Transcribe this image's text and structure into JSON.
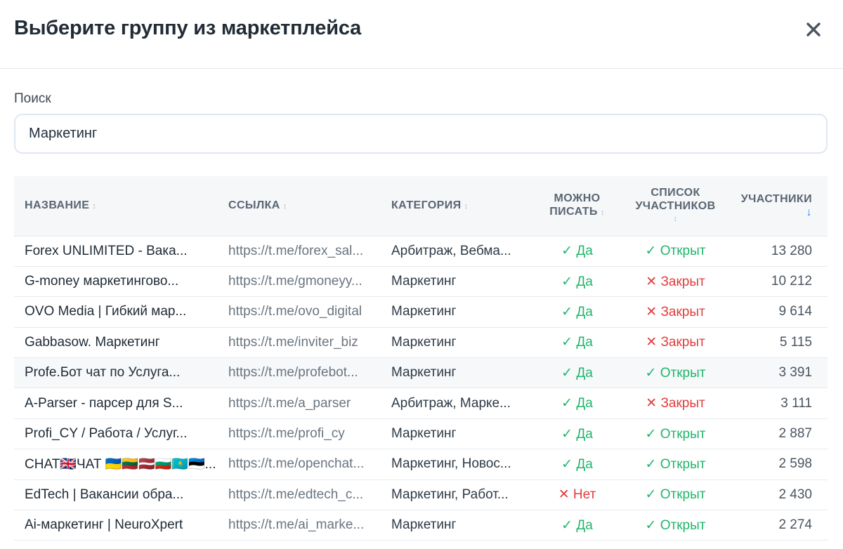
{
  "dialog": {
    "title": "Выберите группу из маркетплейса",
    "close_icon": "close-icon"
  },
  "search": {
    "label": "Поиск",
    "value": "Маркетинг"
  },
  "table": {
    "columns": {
      "name": "НАЗВАНИЕ",
      "link": "ССЫЛКА",
      "category": "КАТЕГОРИЯ",
      "can_write_1": "МОЖНО",
      "can_write_2": "ПИСАТЬ",
      "members_list_1": "СПИСОК",
      "members_list_2": "УЧАСТНИКОВ",
      "participants": "УЧАСТНИКИ"
    },
    "sort": {
      "participants": "descending"
    },
    "rows": [
      {
        "name": "Forex UNLIMITED - Вака...",
        "link": "https://t.me/forex_sal...",
        "category": "Арбитраж, Вебма...",
        "can_write": "✓ Да",
        "can_write_status": "yes",
        "members": "✓ Открыт",
        "members_status": "yes",
        "count": "13 280",
        "highlighted": false
      },
      {
        "name": "G-money маркетингово...",
        "link": "https://t.me/gmoneyy...",
        "category": "Маркетинг",
        "can_write": "✓ Да",
        "can_write_status": "yes",
        "members": "✕ Закрыт",
        "members_status": "no",
        "count": "10 212",
        "highlighted": false
      },
      {
        "name": "OVO Media | Гибкий мар...",
        "link": "https://t.me/ovo_digital",
        "category": "Маркетинг",
        "can_write": "✓ Да",
        "can_write_status": "yes",
        "members": "✕ Закрыт",
        "members_status": "no",
        "count": "9 614",
        "highlighted": false
      },
      {
        "name": "Gabbasow. Маркетинг",
        "link": "https://t.me/inviter_biz",
        "category": "Маркетинг",
        "can_write": "✓ Да",
        "can_write_status": "yes",
        "members": "✕ Закрыт",
        "members_status": "no",
        "count": "5 115",
        "highlighted": false
      },
      {
        "name": "Profe.Бот чат по Услуга...",
        "link": "https://t.me/profebot...",
        "category": "Маркетинг",
        "can_write": "✓ Да",
        "can_write_status": "yes",
        "members": "✓ Открыт",
        "members_status": "yes",
        "count": "3 391",
        "highlighted": true
      },
      {
        "name": "A-Parser - парсер для S...",
        "link": "https://t.me/a_parser",
        "category": "Арбитраж, Марке...",
        "can_write": "✓ Да",
        "can_write_status": "yes",
        "members": "✕ Закрыт",
        "members_status": "no",
        "count": "3 111",
        "highlighted": false
      },
      {
        "name": "Profi_CY / Работа / Услуг...",
        "link": "https://t.me/profi_cy",
        "category": "Маркетинг",
        "can_write": "✓ Да",
        "can_write_status": "yes",
        "members": "✓ Открыт",
        "members_status": "yes",
        "count": "2 887",
        "highlighted": false
      },
      {
        "name": "CHAT🇬🇧ЧАТ 🇺🇦🇱🇹🇱🇻🇧🇬🇰🇿🇪🇪...",
        "link": "https://t.me/openchat...",
        "category": "Маркетинг, Новос...",
        "can_write": "✓ Да",
        "can_write_status": "yes",
        "members": "✓ Открыт",
        "members_status": "yes",
        "count": "2 598",
        "highlighted": false
      },
      {
        "name": "EdTech | Вакансии обра...",
        "link": "https://t.me/edtech_c...",
        "category": "Маркетинг, Работ...",
        "can_write": "✕ Нет",
        "can_write_status": "no",
        "members": "✓ Открыт",
        "members_status": "yes",
        "count": "2 430",
        "highlighted": false
      },
      {
        "name": "Ai-маркетинг | NeuroXpert",
        "link": "https://t.me/ai_marke...",
        "category": "Маркетинг",
        "can_write": "✓ Да",
        "can_write_status": "yes",
        "members": "✓ Открыт",
        "members_status": "yes",
        "count": "2 274",
        "highlighted": false
      }
    ]
  },
  "colors": {
    "yes": "#21b56b",
    "no": "#e23c3c",
    "accent": "#1d8cf2"
  }
}
